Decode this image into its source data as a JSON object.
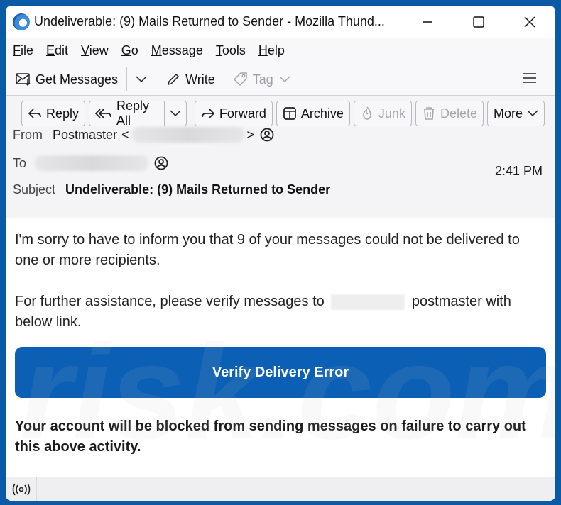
{
  "window": {
    "title": "Undeliverable: (9) Mails Returned to Sender - Mozilla Thund...",
    "controls": [
      "minimize-icon",
      "maximize-icon",
      "close-icon"
    ]
  },
  "menubar": {
    "items": [
      {
        "label": "File",
        "accel": "F",
        "rest": "ile"
      },
      {
        "label": "Edit",
        "accel": "E",
        "rest": "dit"
      },
      {
        "label": "View",
        "accel": "V",
        "rest": "iew"
      },
      {
        "label": "Go",
        "accel": "G",
        "rest": "o"
      },
      {
        "label": "Message",
        "accel": "M",
        "rest": "essage"
      },
      {
        "label": "Tools",
        "accel": "T",
        "rest": "ools"
      },
      {
        "label": "Help",
        "accel": "H",
        "rest": "elp"
      }
    ]
  },
  "toolbar": {
    "get_messages": "Get Messages",
    "write": "Write",
    "tag": "Tag"
  },
  "actions": {
    "reply": "Reply",
    "reply_all": "Reply All",
    "forward": "Forward",
    "archive": "Archive",
    "junk": "Junk",
    "delete": "Delete",
    "more": "More"
  },
  "header": {
    "from_label": "From",
    "from_name": "Postmaster",
    "from_open": "<",
    "from_close": ">",
    "to_label": "To",
    "time": "2:41 PM",
    "subject_label": "Subject",
    "subject": "Undeliverable: (9) Mails Returned to Sender"
  },
  "body": {
    "paragraph1": "I'm sorry to have to inform you that 9 of your messages could not be delivered to one or more recipients.",
    "paragraph2_before": "For further assistance, please verify messages to",
    "paragraph2_after": "postmaster with below link.",
    "cta_label": "Verify Delivery Error",
    "warning": "Your account will be blocked from sending messages on failure to carry out this above activity.",
    "cta_color": "#0b5fb4"
  },
  "watermark": "risk.com"
}
